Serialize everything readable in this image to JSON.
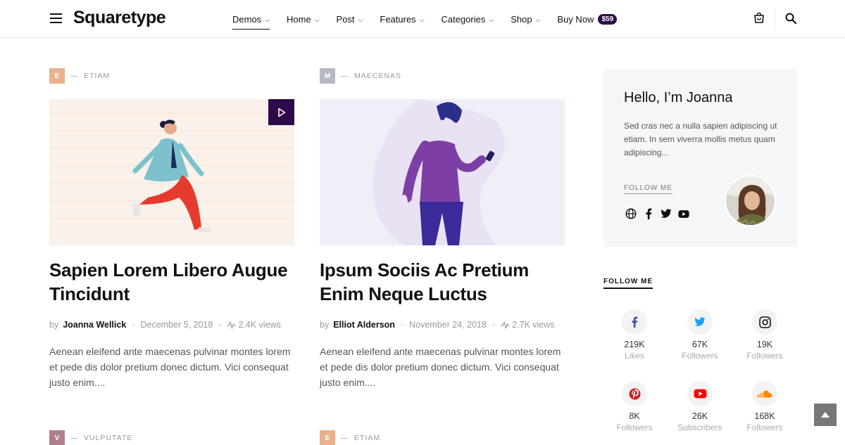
{
  "header": {
    "logo": "Squaretype",
    "nav": [
      {
        "label": "Demos",
        "dropdown": true,
        "active": true
      },
      {
        "label": "Home",
        "dropdown": true
      },
      {
        "label": "Post",
        "dropdown": true
      },
      {
        "label": "Features",
        "dropdown": true
      },
      {
        "label": "Categories",
        "dropdown": true
      },
      {
        "label": "Shop",
        "dropdown": true
      }
    ],
    "buy_now": {
      "label": "Buy Now",
      "badge": "$59"
    },
    "icons": [
      "menu-icon",
      "cart-icon",
      "search-icon"
    ]
  },
  "posts": [
    {
      "category_letter": "E",
      "category_color": "#e8b28c",
      "category": "ETIAM",
      "title": "Sapien Lorem Libero Augue Tincidunt",
      "by": "by",
      "author": "Joanna Wellick",
      "date": "December 5, 2018",
      "views": "2.4K views",
      "excerpt": "Aenean eleifend ante maecenas pulvinar montes lorem et pede dis dolor pretium donec dictum. Vici consequat justo enim....",
      "has_video": true,
      "thumb_bg": "#f9f1ea"
    },
    {
      "category_letter": "M",
      "category_color": "#b6b8c4",
      "category": "MAECENAS",
      "title": "Ipsum Sociis Ac Pretium Enim Neque Luctus",
      "by": "by",
      "author": "Elliot Alderson",
      "date": "November 24, 2018",
      "views": "2.7K views",
      "excerpt": "Aenean eleifend ante maecenas pulvinar montes lorem et pede dis dolor pretium donec dictum. Vici consequat justo enim....",
      "has_video": false,
      "thumb_bg": "#f1eef8"
    }
  ],
  "next_posts": [
    {
      "category_letter": "V",
      "category_color": "#b07f8a",
      "category": "VULPUTATE"
    },
    {
      "category_letter": "E",
      "category_color": "#e8b28c",
      "category": "ETIAM"
    }
  ],
  "about": {
    "hello": "Hello, I’m Joanna",
    "bio": "Sed cras nec a nulla sapien adipiscing ut etiam. In sem viverra mollis metus quam adipiscing...",
    "follow_me": "FOLLOW ME",
    "socials": [
      "globe-icon",
      "facebook-icon",
      "twitter-icon",
      "youtube-icon"
    ]
  },
  "follow_widget": {
    "title": "FOLLOW ME",
    "counters": [
      {
        "icon": "facebook-icon",
        "count": "219K",
        "label": "Likes",
        "color": "#3b5998"
      },
      {
        "icon": "twitter-icon",
        "count": "67K",
        "label": "Followers",
        "color": "#1da1f2"
      },
      {
        "icon": "instagram-icon",
        "count": "19K",
        "label": "Followers",
        "color": "#111111"
      },
      {
        "icon": "pinterest-icon",
        "count": "8K",
        "label": "Followers",
        "color": "#cb2027"
      },
      {
        "icon": "youtube-icon",
        "count": "26K",
        "label": "Subscribers",
        "color": "#ff0000"
      },
      {
        "icon": "soundcloud-icon",
        "count": "168K",
        "label": "Followers",
        "color": "#ff8800"
      }
    ]
  }
}
